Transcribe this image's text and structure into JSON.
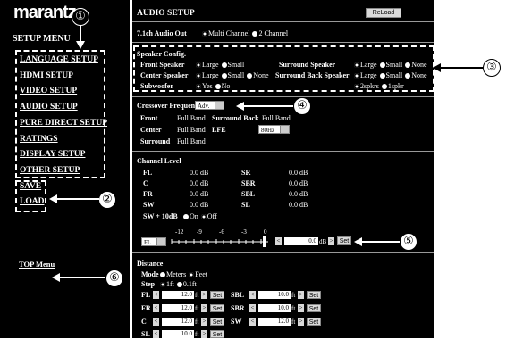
{
  "sidebar": {
    "logo": "marantz",
    "setup_menu": "SETUP MENU",
    "items": [
      "LANGUAGE SETUP",
      "HDMI SETUP",
      "VIDEO SETUP",
      "AUDIO SETUP",
      "PURE DIRECT SETUP",
      "RATINGS",
      "DISPLAY SETUP",
      "OTHER SETUP"
    ],
    "save": "SAVE",
    "load": "LOAD",
    "top_menu": "TOP Menu"
  },
  "callouts": [
    "①",
    "②",
    "③",
    "④",
    "⑤",
    "⑥"
  ],
  "main": {
    "title": "AUDIO SETUP",
    "reload": "ReLoad",
    "audio_out_label": "7.1ch Audio Out",
    "audio_out_options": [
      "Multi Channel",
      "2 Channel"
    ],
    "speaker_config": "Speaker Config.",
    "front_speaker": "Front Speaker",
    "center_speaker": "Center Speaker",
    "subwoofer": "Subwoofer",
    "surround_speaker": "Surround Speaker",
    "surround_back_speaker": "Surround Back Speaker",
    "opt_large": "Large",
    "opt_small": "Small",
    "opt_none": "None",
    "opt_yes": "Yes",
    "opt_no": "No",
    "opt_2spkrs": "2spkrs",
    "opt_1spkr": "1spkr",
    "crossover_label": "Crossover Frequency",
    "crossover_value": "Adv.",
    "xo_front": "Front",
    "xo_full1": "Full Band",
    "xo_surround_back": "Surround Back",
    "xo_full2": "Full Band",
    "xo_center": "Center",
    "xo_full3": "Full Band",
    "xo_lfe": "LFE",
    "xo_lfe_value": "80Hz",
    "xo_surround": "Surround",
    "xo_full4": "Full Band",
    "channel_level": "Channel Level",
    "levels_left": [
      [
        "FL",
        "0.0 dB"
      ],
      [
        "C",
        "0.0 dB"
      ],
      [
        "FR",
        "0.0 dB"
      ],
      [
        "SW",
        "0.0 dB"
      ]
    ],
    "levels_right": [
      [
        "SR",
        "0.0 dB"
      ],
      [
        "SBR",
        "0.0 dB"
      ],
      [
        "SBL",
        "0.0 dB"
      ],
      [
        "SL",
        "0.0 dB"
      ]
    ],
    "sw_10db": "SW + 10dB",
    "sw_on": "On",
    "sw_off": "Off",
    "slider_channel": "FL",
    "slider_ticks": [
      "-12",
      "-9",
      "-6",
      "-3",
      "0"
    ],
    "slider_value": "0.0",
    "slider_unit": "dB",
    "set": "Set",
    "distance": "Distance",
    "mode": "Mode",
    "meters": "Meters",
    "feet": "Feet",
    "step": "Step",
    "step_1ft": "1ft",
    "step_01ft": "0.1ft",
    "dist_left": [
      [
        "FL",
        "12.0"
      ],
      [
        "FR",
        "12.0"
      ],
      [
        "C",
        "12.0"
      ],
      [
        "SL",
        "10.0"
      ]
    ],
    "dist_right": [
      [
        "SBL",
        "10.0"
      ],
      [
        "SBR",
        "10.0"
      ],
      [
        "SW",
        "12.0"
      ]
    ],
    "ft": "ft",
    "lt": "<",
    "gt": ">"
  }
}
